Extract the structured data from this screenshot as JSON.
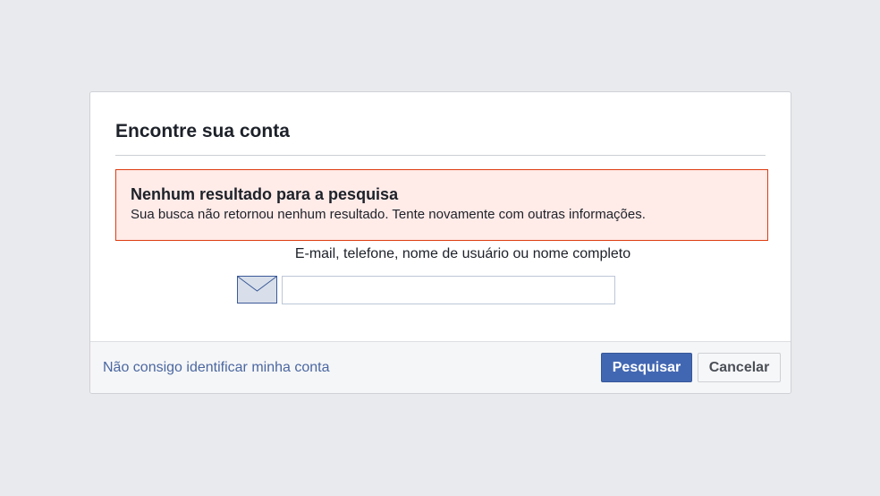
{
  "dialog": {
    "title": "Encontre sua conta"
  },
  "error": {
    "title": "Nenhum resultado para a pesquisa",
    "message": "Sua busca não retornou nenhum resultado. Tente novamente com outras informações."
  },
  "search": {
    "label": "E-mail, telefone, nome de usuário ou nome completo",
    "value": "",
    "icon": "envelope-icon"
  },
  "footer": {
    "link_label": "Não consigo identificar minha conta",
    "search_button": "Pesquisar",
    "cancel_button": "Cancelar"
  },
  "colors": {
    "primary": "#4267b2",
    "error_border": "#dd3c10",
    "error_background": "#ffebe8",
    "link": "#4b67a1"
  }
}
